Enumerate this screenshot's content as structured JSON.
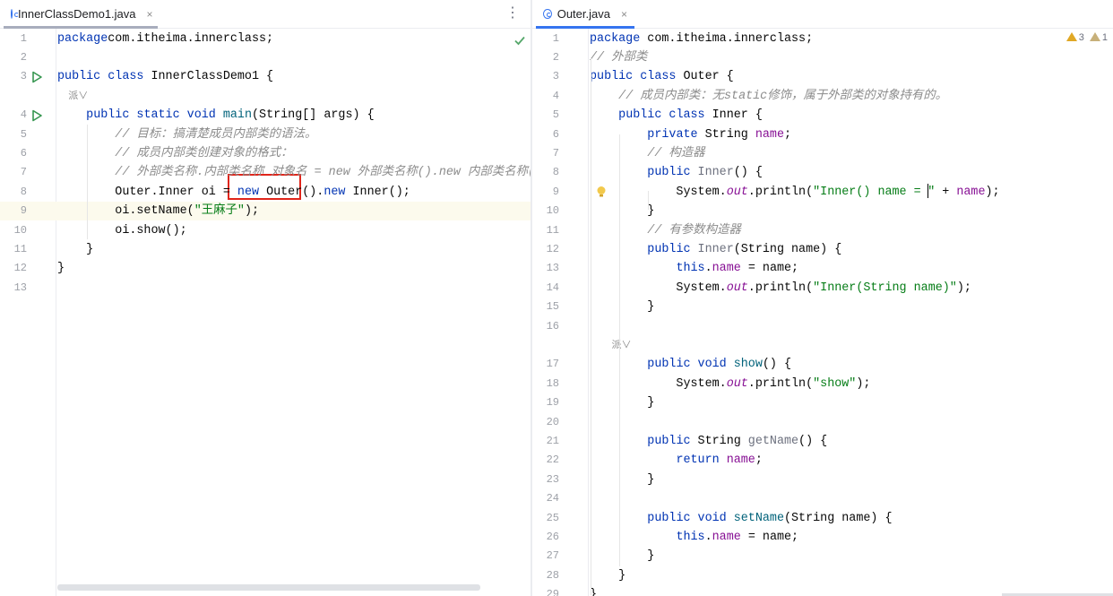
{
  "left_editor": {
    "tab": {
      "title": "InnerClassDemo1.java",
      "close": "×"
    },
    "menu_icon": "more-vertical-icon",
    "lines": [
      {
        "n": "1",
        "tokens": [
          [
            "kw",
            "package"
          ],
          [
            "",
            "com.itheima.innerclass;"
          ]
        ]
      },
      {
        "n": "2",
        "tokens": []
      },
      {
        "n": "3",
        "tokens": [
          [
            "kw",
            "public class "
          ],
          [
            "",
            "InnerClassDemo1 {"
          ]
        ],
        "run": true
      },
      {
        "n": "",
        "tokens": [
          [
            "hint",
            "    "
          ],
          [
            "hint",
            "派∨"
          ]
        ],
        "hint": true
      },
      {
        "n": "4",
        "tokens": [
          [
            "",
            "    "
          ],
          [
            "kw",
            "public static void "
          ],
          [
            "fn",
            "main"
          ],
          [
            "",
            "(String[] args) {"
          ]
        ],
        "run": true
      },
      {
        "n": "5",
        "tokens": [
          [
            "",
            "        "
          ],
          [
            "cm",
            "// 目标：搞清楚成员内部类的语法。"
          ]
        ]
      },
      {
        "n": "6",
        "tokens": [
          [
            "",
            "        "
          ],
          [
            "cm",
            "// 成员内部类创建对象的格式："
          ]
        ]
      },
      {
        "n": "7",
        "tokens": [
          [
            "",
            "        "
          ],
          [
            "cm",
            "// 外部类名称.内部类名称 对象名 = new 外部类名称().new 内部类名称();"
          ]
        ]
      },
      {
        "n": "8",
        "tokens": [
          [
            "",
            "        Outer.Inner oi = "
          ],
          [
            "kw",
            "new "
          ],
          [
            "",
            "Outer()."
          ],
          [
            "kw",
            "new "
          ],
          [
            "",
            "Inner();"
          ]
        ]
      },
      {
        "n": "9",
        "tokens": [
          [
            "",
            "        oi.setName("
          ],
          [
            "str",
            "\"王麻子\""
          ],
          [
            "",
            ");"
          ]
        ],
        "current": true
      },
      {
        "n": "10",
        "tokens": [
          [
            "",
            "        oi.show();"
          ]
        ]
      },
      {
        "n": "11",
        "tokens": [
          [
            "",
            "    }"
          ]
        ]
      },
      {
        "n": "12",
        "tokens": [
          [
            "",
            "}"
          ]
        ]
      },
      {
        "n": "13",
        "tokens": []
      }
    ]
  },
  "right_editor": {
    "tab": {
      "title": "Outer.java",
      "close": "×"
    },
    "inspections": {
      "warnings": "3",
      "weak_warnings": "1"
    },
    "lines": [
      {
        "n": "1",
        "tokens": [
          [
            "kw",
            "package "
          ],
          [
            "",
            "com.itheima.innerclass;"
          ]
        ]
      },
      {
        "n": "2",
        "tokens": [
          [
            "cm",
            "// 外部类"
          ]
        ]
      },
      {
        "n": "3",
        "tokens": [
          [
            "kw",
            "public class "
          ],
          [
            "",
            "Outer {"
          ]
        ]
      },
      {
        "n": "4",
        "tokens": [
          [
            "",
            "    "
          ],
          [
            "cm",
            "// 成员内部类：无static修饰，属于外部类的对象持有的。"
          ]
        ]
      },
      {
        "n": "5",
        "tokens": [
          [
            "",
            "    "
          ],
          [
            "kw",
            "public class "
          ],
          [
            "",
            "Inner {"
          ]
        ]
      },
      {
        "n": "6",
        "tokens": [
          [
            "",
            "        "
          ],
          [
            "kw",
            "private "
          ],
          [
            "",
            "String "
          ],
          [
            "fld",
            "name"
          ],
          [
            "",
            ";"
          ]
        ]
      },
      {
        "n": "7",
        "tokens": [
          [
            "",
            "        "
          ],
          [
            "cm",
            "// 构造器"
          ]
        ]
      },
      {
        "n": "8",
        "tokens": [
          [
            "",
            "        "
          ],
          [
            "kw",
            "public "
          ],
          [
            "unused",
            "Inner"
          ],
          [
            "",
            "() {"
          ]
        ]
      },
      {
        "n": "9",
        "tokens": [
          [
            "",
            "            System."
          ],
          [
            "st",
            "out"
          ],
          [
            "",
            ".println("
          ],
          [
            "str",
            "\"Inner() name = "
          ],
          [
            "caret",
            ""
          ],
          [
            "str",
            "\""
          ],
          [
            "",
            " + "
          ],
          [
            "fld",
            "name"
          ],
          [
            "",
            ");"
          ]
        ],
        "bulb": true
      },
      {
        "n": "10",
        "tokens": [
          [
            "",
            "        }"
          ]
        ]
      },
      {
        "n": "11",
        "tokens": [
          [
            "",
            "        "
          ],
          [
            "cm",
            "// 有参数构造器"
          ]
        ]
      },
      {
        "n": "12",
        "tokens": [
          [
            "",
            "        "
          ],
          [
            "kw",
            "public "
          ],
          [
            "unused",
            "Inner"
          ],
          [
            "",
            "(String name) {"
          ]
        ]
      },
      {
        "n": "13",
        "tokens": [
          [
            "",
            "            "
          ],
          [
            "kw",
            "this"
          ],
          [
            "",
            "."
          ],
          [
            "fld",
            "name"
          ],
          [
            "",
            " = name;"
          ]
        ]
      },
      {
        "n": "14",
        "tokens": [
          [
            "",
            "            System."
          ],
          [
            "st",
            "out"
          ],
          [
            "",
            ".println("
          ],
          [
            "str",
            "\"Inner(String name)\""
          ],
          [
            "",
            ");"
          ]
        ]
      },
      {
        "n": "15",
        "tokens": [
          [
            "",
            "        }"
          ]
        ]
      },
      {
        "n": "16",
        "tokens": []
      },
      {
        "n": "",
        "tokens": [
          [
            "hint",
            "        "
          ],
          [
            "hint",
            "派∨"
          ]
        ],
        "hint": true
      },
      {
        "n": "17",
        "tokens": [
          [
            "",
            "        "
          ],
          [
            "kw",
            "public void "
          ],
          [
            "fn",
            "show"
          ],
          [
            "",
            "() {"
          ]
        ]
      },
      {
        "n": "18",
        "tokens": [
          [
            "",
            "            System."
          ],
          [
            "st",
            "out"
          ],
          [
            "",
            ".println("
          ],
          [
            "str",
            "\"show\""
          ],
          [
            "",
            ");"
          ]
        ]
      },
      {
        "n": "19",
        "tokens": [
          [
            "",
            "        }"
          ]
        ]
      },
      {
        "n": "20",
        "tokens": []
      },
      {
        "n": "21",
        "tokens": [
          [
            "",
            "        "
          ],
          [
            "kw",
            "public "
          ],
          [
            "",
            "String "
          ],
          [
            "unused",
            "getName"
          ],
          [
            "",
            "() {"
          ]
        ]
      },
      {
        "n": "22",
        "tokens": [
          [
            "",
            "            "
          ],
          [
            "kw",
            "return "
          ],
          [
            "fld",
            "name"
          ],
          [
            "",
            ";"
          ]
        ]
      },
      {
        "n": "23",
        "tokens": [
          [
            "",
            "        }"
          ]
        ]
      },
      {
        "n": "24",
        "tokens": []
      },
      {
        "n": "25",
        "tokens": [
          [
            "",
            "        "
          ],
          [
            "kw",
            "public void "
          ],
          [
            "fn",
            "setName"
          ],
          [
            "",
            "(String name) {"
          ]
        ]
      },
      {
        "n": "26",
        "tokens": [
          [
            "",
            "            "
          ],
          [
            "kw",
            "this"
          ],
          [
            "",
            "."
          ],
          [
            "fld",
            "name"
          ],
          [
            "",
            " = name;"
          ]
        ]
      },
      {
        "n": "27",
        "tokens": [
          [
            "",
            "        }"
          ]
        ]
      },
      {
        "n": "28",
        "tokens": [
          [
            "",
            "    }"
          ]
        ]
      },
      {
        "n": "29",
        "tokens": [
          [
            "",
            "}"
          ]
        ]
      }
    ]
  }
}
